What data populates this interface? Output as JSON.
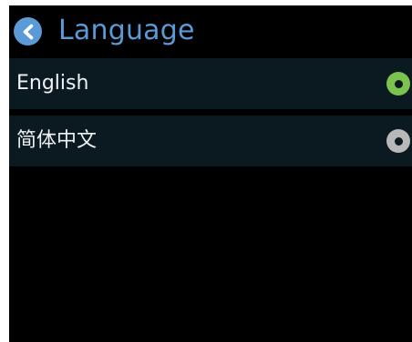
{
  "header": {
    "title": "Language",
    "back_icon": "chevron-left-icon"
  },
  "languages": [
    {
      "label": "English",
      "selected": true
    },
    {
      "label": "简体中文",
      "selected": false
    }
  ],
  "colors": {
    "accent": "#5a9ad6",
    "selected_radio": "#7bc24f",
    "unselected_radio": "#b8b8b8",
    "item_background": "#0b1a20",
    "screen_background": "#000000",
    "text": "#eef2f5"
  }
}
